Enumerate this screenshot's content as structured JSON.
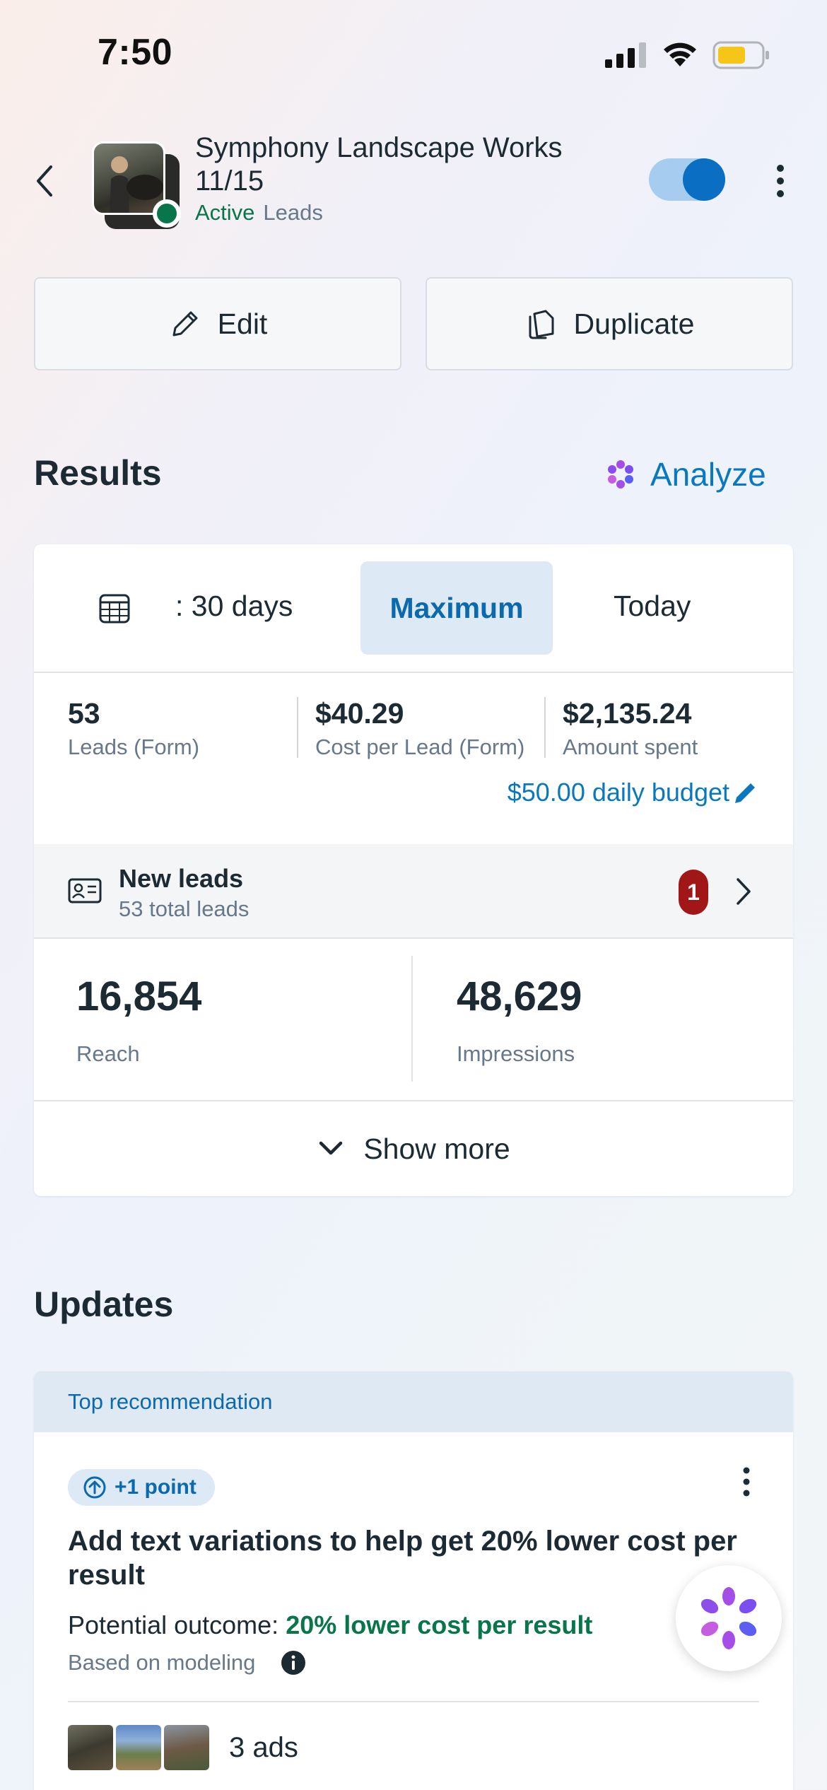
{
  "status_bar": {
    "time": "7:50"
  },
  "header": {
    "title": "Symphony Landscape Works 11/15",
    "status": "Active",
    "objective": "Leads",
    "toggle_on": true
  },
  "actions": {
    "edit_label": "Edit",
    "duplicate_label": "Duplicate"
  },
  "results": {
    "title": "Results",
    "analyze_label": "Analyze",
    "date_range": {
      "days_label": ": 30 days",
      "maximum_label": "Maximum",
      "today_label": "Today",
      "selected": "Maximum"
    },
    "metrics": [
      {
        "value": "53",
        "label": "Leads (Form)"
      },
      {
        "value": "$40.29",
        "label": "Cost per Lead (Form)"
      },
      {
        "value": "$2,135.24",
        "label": "Amount spent"
      }
    ],
    "budget_label": "$50.00 daily budget",
    "new_leads": {
      "title": "New leads",
      "subtitle": "53 total leads",
      "badge": "1"
    },
    "stats": [
      {
        "value": "16,854",
        "label": "Reach"
      },
      {
        "value": "48,629",
        "label": "Impressions"
      }
    ],
    "show_more_label": "Show more"
  },
  "updates": {
    "title": "Updates",
    "recommendation": {
      "header": "Top recommendation",
      "pill": "+1 point",
      "title": "Add text variations to help get 20% lower cost per result",
      "outcome_label": "Potential outcome:",
      "outcome_value": "20% lower cost per result",
      "note": "Based on modeling",
      "ads_count": "3 ads"
    }
  },
  "colors": {
    "accent": "#0a78be",
    "active_green": "#09754b",
    "badge_red": "#a11717",
    "toggle_track": "#a6cdef",
    "toggle_knob": "#0a6fc2"
  }
}
